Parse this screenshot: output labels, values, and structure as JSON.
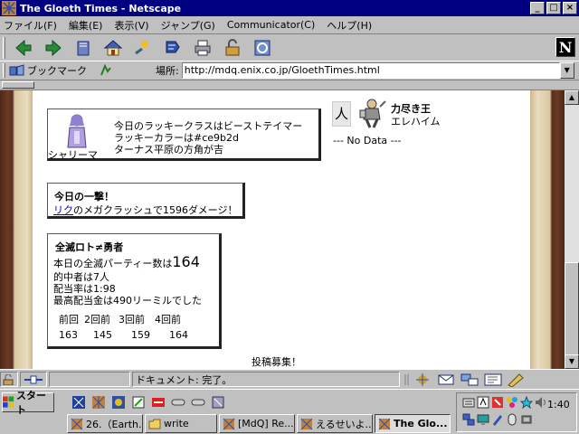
{
  "window": {
    "title": "The Gloeth Times - Netscape"
  },
  "menu": [
    "ファイル(F)",
    "編集(E)",
    "表示(V)",
    "ジャンプ(G)",
    "Communicator(C)",
    "ヘルプ(H)"
  ],
  "location": {
    "bookmarks_label": "ブックマーク",
    "label": "場所:",
    "url": "http://mdq.enix.co.jp/GloethTimes.html"
  },
  "lucky": {
    "character": "シャリーマ",
    "line1": "今日のラッキークラスはビーストテイマー",
    "line2": "ラッキーカラーは#ce9b2d",
    "line3": "ターナス平原の方角が吉"
  },
  "power_king": {
    "kanji": "人",
    "title": "力尽き王",
    "name": "エレハイム",
    "nodata": "--- No Data ---"
  },
  "strike": {
    "heading": "今日の一撃！",
    "link": "リク",
    "text": "のメガクラッシュで1596ダメージ！"
  },
  "lottery": {
    "heading": "全滅ロト≠勇者",
    "count_prefix": "本日の全滅パーティー数は",
    "count": "164",
    "winners": "的中者は7人",
    "payout_rate": "配当率は1:98",
    "max_payout": "最高配当金は490リーミルでした",
    "history_headers": [
      "前回",
      "2回前",
      "3回前",
      "4回前"
    ],
    "history_values": [
      "163",
      "145",
      "159",
      "164"
    ]
  },
  "footer_text": "投稿募集！",
  "status": {
    "text": "ドキュメント: 完了。"
  },
  "taskbar": {
    "start": "スタート",
    "tasks": [
      "26.（Earth...",
      "write",
      "[MdQ] Re...",
      "えるせいよ...",
      "The Glo..."
    ],
    "clock": "1:40"
  }
}
